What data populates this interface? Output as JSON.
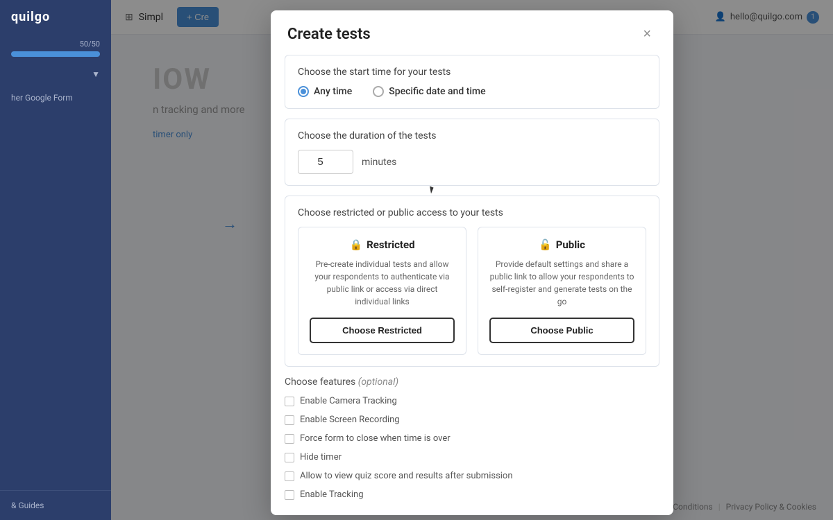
{
  "app": {
    "logo": "quilgo",
    "progress": {
      "label": "50/50",
      "percent": 100
    },
    "sidebar": {
      "google_form_label": "her Google Form",
      "help_label": "& Guides"
    },
    "header": {
      "title": "Simpl",
      "create_button": "+ Cre",
      "user_email": "hello@quilgo.com",
      "user_badge": "1"
    }
  },
  "background": {
    "heading": "IOW",
    "subtext": "n tracking and more",
    "link": "timer only"
  },
  "modal": {
    "title": "Create tests",
    "close_label": "×",
    "section_start": {
      "label": "Choose the start time for your tests",
      "options": [
        {
          "id": "anytime",
          "label": "Any time",
          "selected": true
        },
        {
          "id": "specific",
          "label": "Specific date and time",
          "selected": false
        }
      ]
    },
    "section_duration": {
      "label": "Choose the duration of the tests",
      "value": "5",
      "unit": "minutes"
    },
    "section_access": {
      "label": "Choose restricted or public access to your tests",
      "restricted": {
        "icon": "🔒",
        "title": "Restricted",
        "desc": "Pre-create individual tests and allow your respondents to authenticate via public link or access via direct individual links",
        "button": "Choose Restricted"
      },
      "public": {
        "icon": "🔓",
        "title": "Public",
        "desc": "Provide default settings and share a public link to allow your respondents to self-register and generate tests on the go",
        "button": "Choose Public"
      }
    },
    "section_features": {
      "label": "Choose features",
      "label_optional": "(optional)",
      "items": [
        {
          "id": "camera",
          "label": "Enable Camera Tracking",
          "checked": false
        },
        {
          "id": "screen",
          "label": "Enable Screen Recording",
          "checked": false
        },
        {
          "id": "forceclose",
          "label": "Force form to close when time is over",
          "checked": false
        },
        {
          "id": "hidetimer",
          "label": "Hide timer",
          "checked": false
        },
        {
          "id": "viewscore",
          "label": "Allow to view quiz score and results after submission",
          "checked": false
        },
        {
          "id": "tracking",
          "label": "Enable Tracking",
          "checked": false
        }
      ]
    }
  },
  "footer": {
    "terms": "Terms & Conditions",
    "privacy": "Privacy Policy & Cookies"
  }
}
